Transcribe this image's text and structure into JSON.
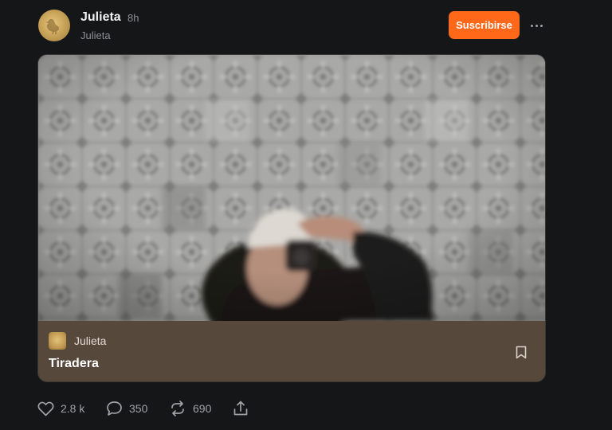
{
  "post": {
    "author": {
      "name": "Julieta",
      "time": "8h",
      "subtitle": "Julieta",
      "avatar_icon": "duck-avatar-icon"
    },
    "subscribe_label": "Suscribirse",
    "more_icon": "more-horizontal-icon",
    "card": {
      "publication_name": "Julieta",
      "title": "Tiradera",
      "bookmark_icon": "bookmark-icon"
    },
    "actions": {
      "likes": "2.8 k",
      "comments": "350",
      "restacks": "690"
    }
  },
  "colors": {
    "background": "#151617",
    "accent": "#ff6719",
    "card_footer": "#57483c"
  }
}
